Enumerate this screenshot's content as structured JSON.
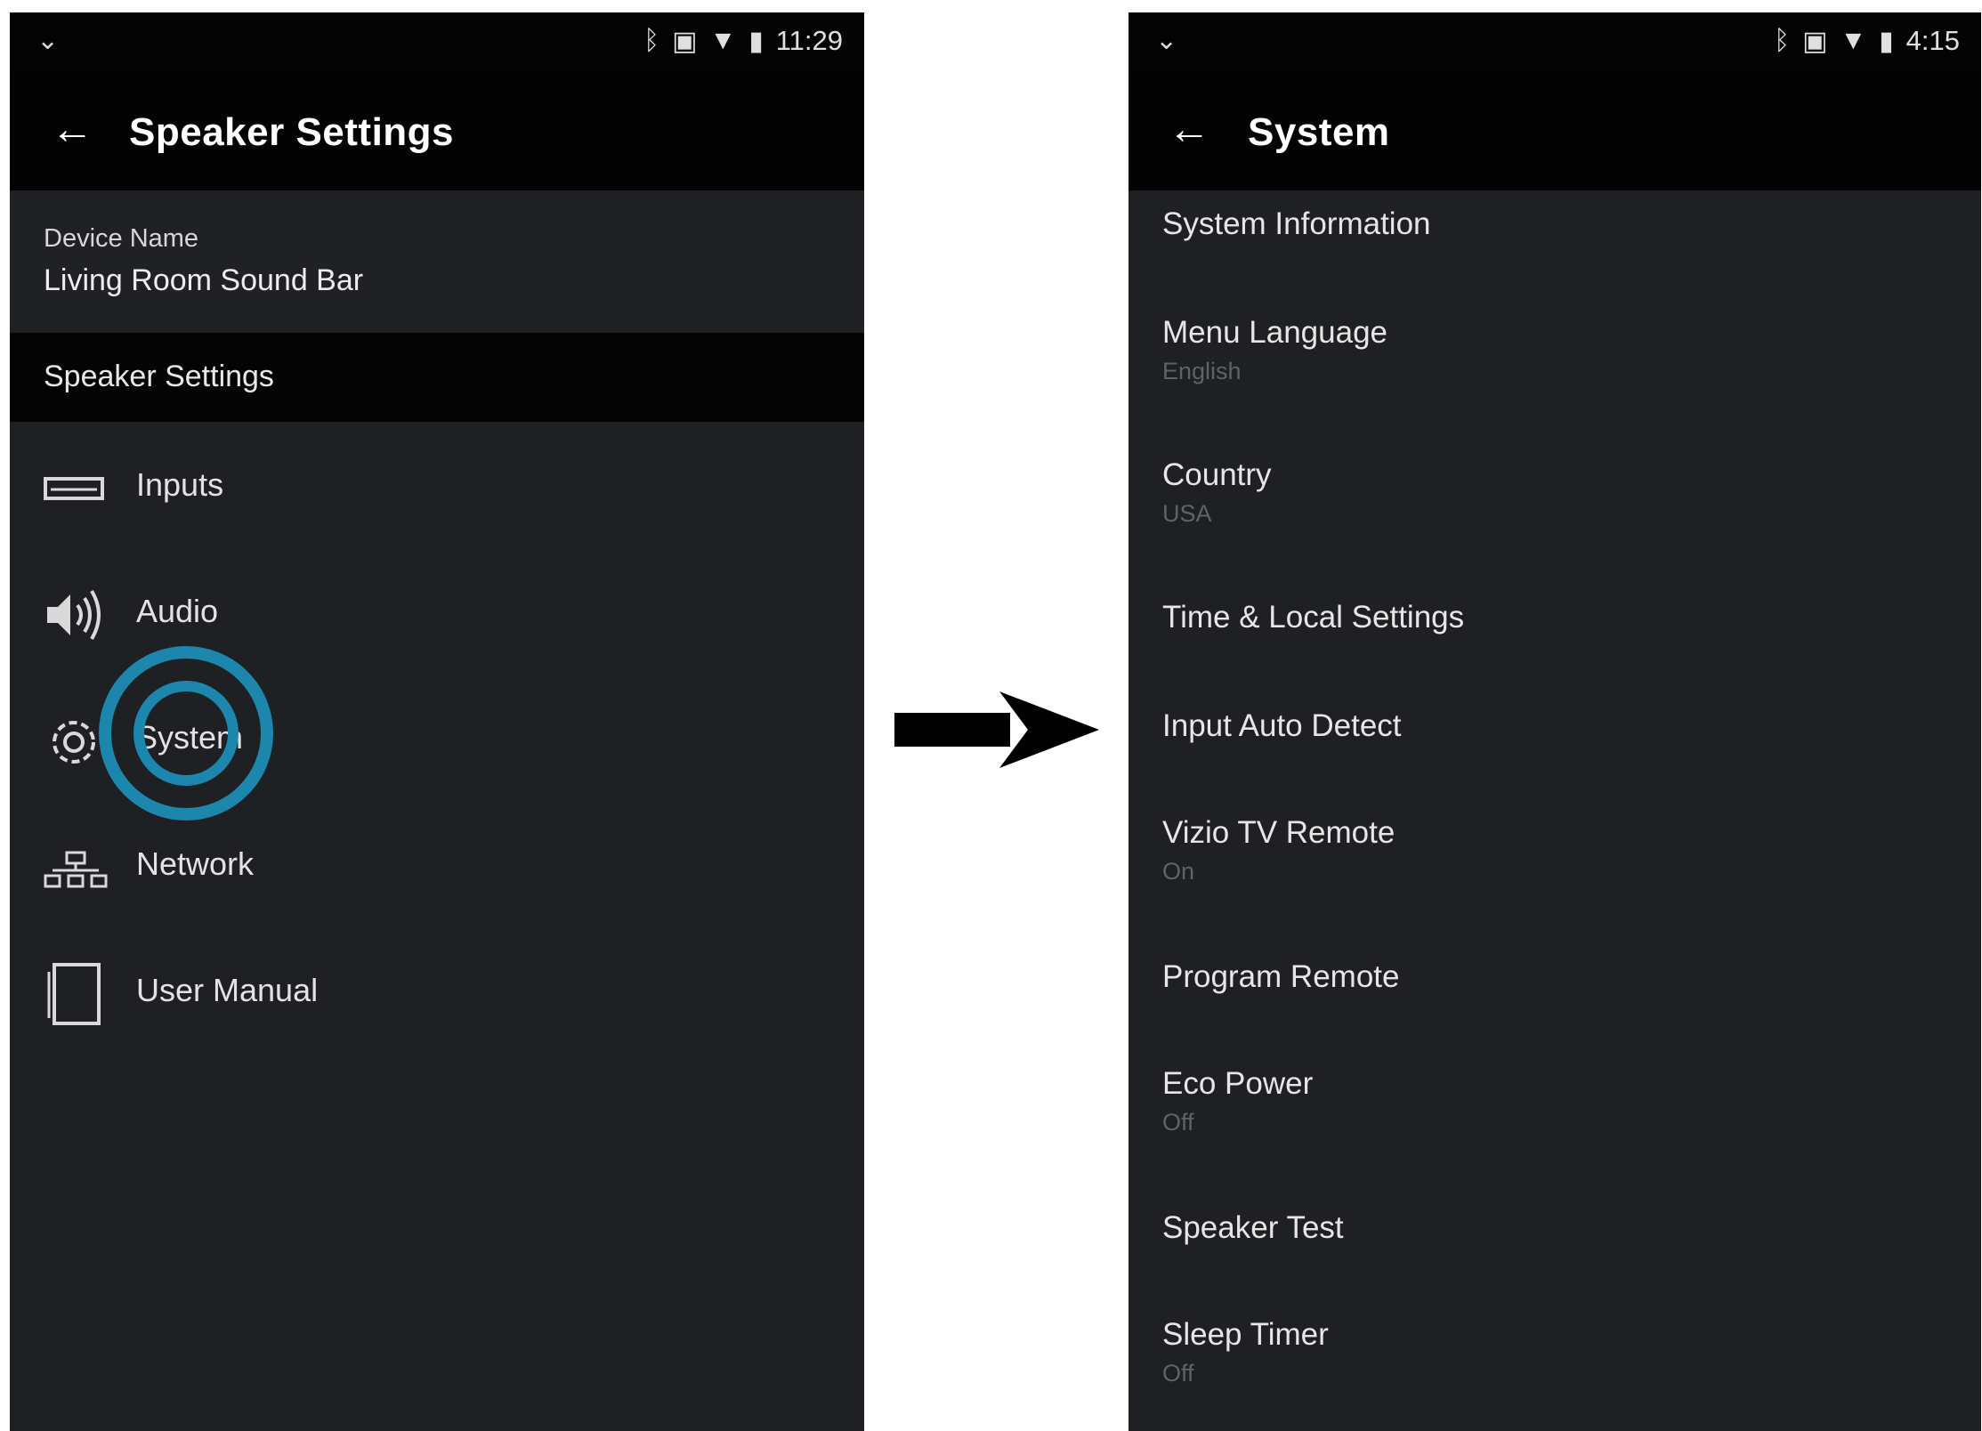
{
  "left_screen": {
    "status_bar": {
      "time": "11:29",
      "icons": [
        "chevron-down-icon",
        "bluetooth-icon",
        "vibrate-icon",
        "wifi-icon",
        "battery-icon"
      ]
    },
    "app_bar": {
      "back_icon": "back-arrow-icon",
      "title": "Speaker Settings"
    },
    "device": {
      "label": "Device Name",
      "value": "Living Room Sound Bar"
    },
    "section_header": "Speaker Settings",
    "menu": [
      {
        "label": "Inputs",
        "icon": "inputs-icon"
      },
      {
        "label": "Audio",
        "icon": "speaker-icon"
      },
      {
        "label": "System",
        "icon": "gear-icon"
      },
      {
        "label": "Network",
        "icon": "network-icon"
      },
      {
        "label": "User Manual",
        "icon": "book-icon"
      }
    ],
    "tap_indicator_color": "#1c86ad"
  },
  "transition_arrow": "arrow-right-icon",
  "right_screen": {
    "status_bar": {
      "time": "4:15",
      "icons": [
        "chevron-down-icon",
        "bluetooth-icon",
        "vibrate-icon",
        "wifi-icon",
        "battery-icon"
      ]
    },
    "app_bar": {
      "back_icon": "back-arrow-icon",
      "title": "System"
    },
    "menu": [
      {
        "label": "System Information",
        "value": ""
      },
      {
        "label": "Menu Language",
        "value": "English"
      },
      {
        "label": "Country",
        "value": "USA"
      },
      {
        "label": "Time & Local Settings",
        "value": ""
      },
      {
        "label": "Input Auto Detect",
        "value": ""
      },
      {
        "label": "Vizio TV Remote",
        "value": "On"
      },
      {
        "label": "Program Remote",
        "value": ""
      },
      {
        "label": "Eco Power",
        "value": "Off"
      },
      {
        "label": "Speaker Test",
        "value": ""
      },
      {
        "label": "Sleep Timer",
        "value": "Off"
      }
    ]
  },
  "colors": {
    "background": "#1e2023",
    "bar": "#040404",
    "accent": "#1c86ad",
    "subtext": "#5f6266"
  }
}
